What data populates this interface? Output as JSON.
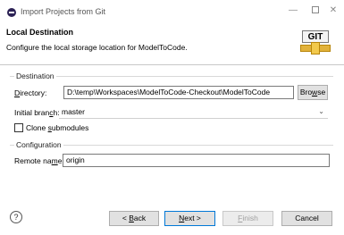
{
  "window": {
    "title": "Import Projects from Git",
    "minimize_glyph": "—",
    "close_glyph": "✕"
  },
  "header": {
    "title": "Local Destination",
    "description": "Configure the local storage location for ModelToCode.",
    "logo_text": "GIT"
  },
  "destination": {
    "group_label": "Destination",
    "directory": {
      "label_pre": "",
      "label_mnemonic": "D",
      "label_post": "irectory:",
      "value": "D:\\temp\\Workspaces\\ModelToCode-Checkout\\ModelToCode"
    },
    "browse": {
      "label_pre": "Bro",
      "label_mnemonic": "w",
      "label_post": "se"
    },
    "branch": {
      "label_pre": "Initial bran",
      "label_mnemonic": "c",
      "label_post": "h:",
      "value": "master",
      "arrow": "⌄"
    },
    "clone_submodules": {
      "label_pre": "Clone ",
      "label_mnemonic": "s",
      "label_post": "ubmodules",
      "checked": false
    }
  },
  "configuration": {
    "group_label": "Configuration",
    "remote": {
      "label_pre": "Remote na",
      "label_mnemonic": "m",
      "label_post": "e:",
      "value": "origin"
    }
  },
  "footer": {
    "help_glyph": "?",
    "back": {
      "pre": "< ",
      "mnemonic": "B",
      "post": "ack"
    },
    "next": {
      "pre": "",
      "mnemonic": "N",
      "post": "ext >"
    },
    "finish": {
      "pre": "",
      "mnemonic": "F",
      "post": "inish"
    },
    "cancel": "Cancel"
  }
}
